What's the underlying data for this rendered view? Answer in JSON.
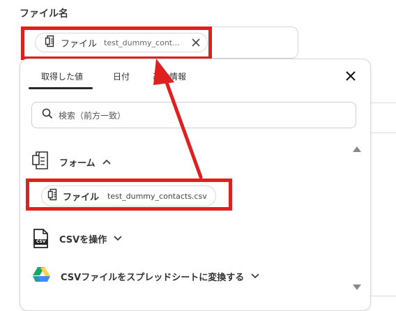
{
  "field": {
    "label": "ファイル名",
    "chip": {
      "category": "ファイル",
      "value": "test_dummy_cont...",
      "remove_icon": "close-icon"
    }
  },
  "panel": {
    "tabs": [
      {
        "label": "取得した値",
        "active": true
      },
      {
        "label": "日付",
        "active": false
      },
      {
        "label": "基本情報",
        "active": false
      }
    ],
    "close_icon": "close-icon",
    "search": {
      "icon": "search-icon",
      "placeholder": "検索（前方一致）"
    },
    "groups": [
      {
        "label": "フォーム",
        "icon": "form-icon",
        "expanded": true
      },
      {
        "label": "CSVを操作",
        "icon": "csv-file-icon",
        "expanded": false
      },
      {
        "label": "CSVファイルをスプレッドシートに変換する",
        "icon": "google-drive-icon",
        "expanded": false
      }
    ],
    "items": [
      {
        "category": "ファイル",
        "value": "test_dummy_contacts.csv",
        "icon": "file-icon"
      }
    ],
    "csv_badge": "CSV"
  },
  "colors": {
    "highlight": "#e02020",
    "text": "#333333",
    "border": "#d6d6d6"
  }
}
